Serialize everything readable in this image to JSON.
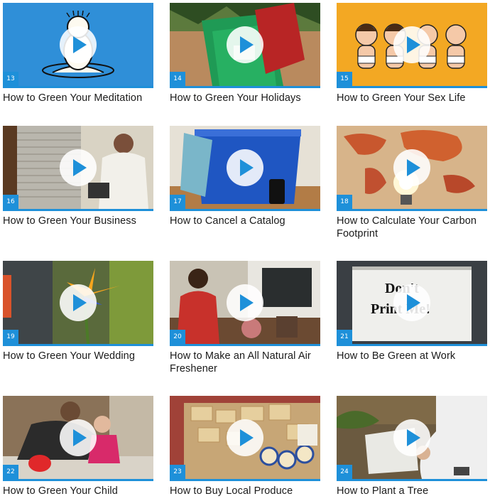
{
  "colors": {
    "accent": "#1e90d9",
    "title_text": "#1a1a1a"
  },
  "icons": {
    "play": "play-icon"
  },
  "videos": [
    {
      "number": "13",
      "title": "How to Green Your Meditation"
    },
    {
      "number": "14",
      "title": "How to Green Your Holidays"
    },
    {
      "number": "15",
      "title": "How to Green Your Sex Life"
    },
    {
      "number": "16",
      "title": "How to Green Your Business"
    },
    {
      "number": "17",
      "title": "How to Cancel a Catalog"
    },
    {
      "number": "18",
      "title": "How to Calculate Your Carbon Footprint"
    },
    {
      "number": "19",
      "title": "How to Green Your Wedding"
    },
    {
      "number": "20",
      "title": "How to Make an All Natural Air Freshener"
    },
    {
      "number": "21",
      "title": "How to Be Green at Work",
      "thumbnail_text": [
        "Don't",
        "Print Me!"
      ]
    },
    {
      "number": "22",
      "title": "How to Green Your Child"
    },
    {
      "number": "23",
      "title": "How to Buy Local Produce"
    },
    {
      "number": "24",
      "title": "How to Plant a Tree"
    }
  ]
}
